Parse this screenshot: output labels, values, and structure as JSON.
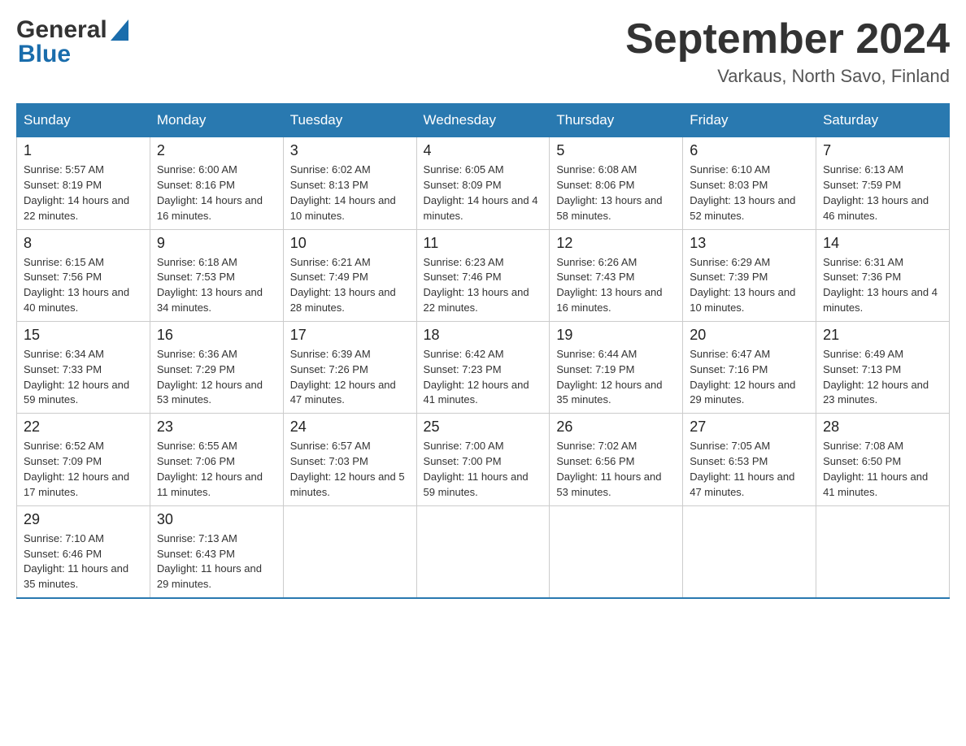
{
  "header": {
    "logo_general": "General",
    "logo_blue": "Blue",
    "month_year": "September 2024",
    "location": "Varkaus, North Savo, Finland"
  },
  "days_of_week": [
    "Sunday",
    "Monday",
    "Tuesday",
    "Wednesday",
    "Thursday",
    "Friday",
    "Saturday"
  ],
  "weeks": [
    [
      {
        "day": "1",
        "sunrise": "Sunrise: 5:57 AM",
        "sunset": "Sunset: 8:19 PM",
        "daylight": "Daylight: 14 hours and 22 minutes."
      },
      {
        "day": "2",
        "sunrise": "Sunrise: 6:00 AM",
        "sunset": "Sunset: 8:16 PM",
        "daylight": "Daylight: 14 hours and 16 minutes."
      },
      {
        "day": "3",
        "sunrise": "Sunrise: 6:02 AM",
        "sunset": "Sunset: 8:13 PM",
        "daylight": "Daylight: 14 hours and 10 minutes."
      },
      {
        "day": "4",
        "sunrise": "Sunrise: 6:05 AM",
        "sunset": "Sunset: 8:09 PM",
        "daylight": "Daylight: 14 hours and 4 minutes."
      },
      {
        "day": "5",
        "sunrise": "Sunrise: 6:08 AM",
        "sunset": "Sunset: 8:06 PM",
        "daylight": "Daylight: 13 hours and 58 minutes."
      },
      {
        "day": "6",
        "sunrise": "Sunrise: 6:10 AM",
        "sunset": "Sunset: 8:03 PM",
        "daylight": "Daylight: 13 hours and 52 minutes."
      },
      {
        "day": "7",
        "sunrise": "Sunrise: 6:13 AM",
        "sunset": "Sunset: 7:59 PM",
        "daylight": "Daylight: 13 hours and 46 minutes."
      }
    ],
    [
      {
        "day": "8",
        "sunrise": "Sunrise: 6:15 AM",
        "sunset": "Sunset: 7:56 PM",
        "daylight": "Daylight: 13 hours and 40 minutes."
      },
      {
        "day": "9",
        "sunrise": "Sunrise: 6:18 AM",
        "sunset": "Sunset: 7:53 PM",
        "daylight": "Daylight: 13 hours and 34 minutes."
      },
      {
        "day": "10",
        "sunrise": "Sunrise: 6:21 AM",
        "sunset": "Sunset: 7:49 PM",
        "daylight": "Daylight: 13 hours and 28 minutes."
      },
      {
        "day": "11",
        "sunrise": "Sunrise: 6:23 AM",
        "sunset": "Sunset: 7:46 PM",
        "daylight": "Daylight: 13 hours and 22 minutes."
      },
      {
        "day": "12",
        "sunrise": "Sunrise: 6:26 AM",
        "sunset": "Sunset: 7:43 PM",
        "daylight": "Daylight: 13 hours and 16 minutes."
      },
      {
        "day": "13",
        "sunrise": "Sunrise: 6:29 AM",
        "sunset": "Sunset: 7:39 PM",
        "daylight": "Daylight: 13 hours and 10 minutes."
      },
      {
        "day": "14",
        "sunrise": "Sunrise: 6:31 AM",
        "sunset": "Sunset: 7:36 PM",
        "daylight": "Daylight: 13 hours and 4 minutes."
      }
    ],
    [
      {
        "day": "15",
        "sunrise": "Sunrise: 6:34 AM",
        "sunset": "Sunset: 7:33 PM",
        "daylight": "Daylight: 12 hours and 59 minutes."
      },
      {
        "day": "16",
        "sunrise": "Sunrise: 6:36 AM",
        "sunset": "Sunset: 7:29 PM",
        "daylight": "Daylight: 12 hours and 53 minutes."
      },
      {
        "day": "17",
        "sunrise": "Sunrise: 6:39 AM",
        "sunset": "Sunset: 7:26 PM",
        "daylight": "Daylight: 12 hours and 47 minutes."
      },
      {
        "day": "18",
        "sunrise": "Sunrise: 6:42 AM",
        "sunset": "Sunset: 7:23 PM",
        "daylight": "Daylight: 12 hours and 41 minutes."
      },
      {
        "day": "19",
        "sunrise": "Sunrise: 6:44 AM",
        "sunset": "Sunset: 7:19 PM",
        "daylight": "Daylight: 12 hours and 35 minutes."
      },
      {
        "day": "20",
        "sunrise": "Sunrise: 6:47 AM",
        "sunset": "Sunset: 7:16 PM",
        "daylight": "Daylight: 12 hours and 29 minutes."
      },
      {
        "day": "21",
        "sunrise": "Sunrise: 6:49 AM",
        "sunset": "Sunset: 7:13 PM",
        "daylight": "Daylight: 12 hours and 23 minutes."
      }
    ],
    [
      {
        "day": "22",
        "sunrise": "Sunrise: 6:52 AM",
        "sunset": "Sunset: 7:09 PM",
        "daylight": "Daylight: 12 hours and 17 minutes."
      },
      {
        "day": "23",
        "sunrise": "Sunrise: 6:55 AM",
        "sunset": "Sunset: 7:06 PM",
        "daylight": "Daylight: 12 hours and 11 minutes."
      },
      {
        "day": "24",
        "sunrise": "Sunrise: 6:57 AM",
        "sunset": "Sunset: 7:03 PM",
        "daylight": "Daylight: 12 hours and 5 minutes."
      },
      {
        "day": "25",
        "sunrise": "Sunrise: 7:00 AM",
        "sunset": "Sunset: 7:00 PM",
        "daylight": "Daylight: 11 hours and 59 minutes."
      },
      {
        "day": "26",
        "sunrise": "Sunrise: 7:02 AM",
        "sunset": "Sunset: 6:56 PM",
        "daylight": "Daylight: 11 hours and 53 minutes."
      },
      {
        "day": "27",
        "sunrise": "Sunrise: 7:05 AM",
        "sunset": "Sunset: 6:53 PM",
        "daylight": "Daylight: 11 hours and 47 minutes."
      },
      {
        "day": "28",
        "sunrise": "Sunrise: 7:08 AM",
        "sunset": "Sunset: 6:50 PM",
        "daylight": "Daylight: 11 hours and 41 minutes."
      }
    ],
    [
      {
        "day": "29",
        "sunrise": "Sunrise: 7:10 AM",
        "sunset": "Sunset: 6:46 PM",
        "daylight": "Daylight: 11 hours and 35 minutes."
      },
      {
        "day": "30",
        "sunrise": "Sunrise: 7:13 AM",
        "sunset": "Sunset: 6:43 PM",
        "daylight": "Daylight: 11 hours and 29 minutes."
      },
      null,
      null,
      null,
      null,
      null
    ]
  ]
}
